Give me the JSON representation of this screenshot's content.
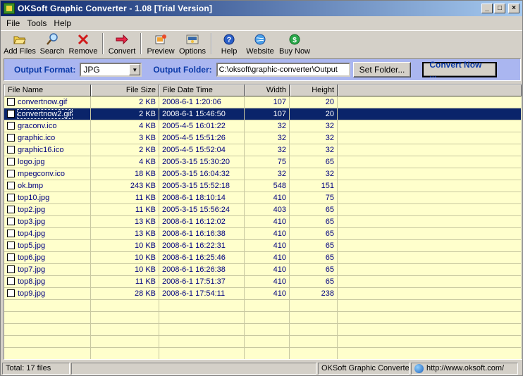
{
  "window": {
    "title": "OKSoft Graphic Converter - 1.08  [Trial Version]",
    "controls": {
      "minimize": "_",
      "maximize": "□",
      "close": "×"
    }
  },
  "menu": [
    {
      "label": "File"
    },
    {
      "label": "Tools"
    },
    {
      "label": "Help"
    }
  ],
  "toolbar": [
    {
      "label": "Add Files",
      "icon": "folder-open-icon"
    },
    {
      "label": "Search",
      "icon": "search-icon"
    },
    {
      "label": "Remove",
      "icon": "remove-x-icon"
    },
    {
      "label": "Convert",
      "icon": "convert-arrow-icon"
    },
    {
      "label": "Preview",
      "icon": "preview-icon"
    },
    {
      "label": "Options",
      "icon": "options-icon"
    },
    {
      "label": "Help",
      "icon": "help-icon"
    },
    {
      "label": "Website",
      "icon": "website-globe-icon"
    },
    {
      "label": "Buy Now",
      "icon": "buy-now-icon"
    }
  ],
  "format_bar": {
    "output_format_label": "Output Format:",
    "output_format_value": "JPG",
    "output_folder_label": "Output Folder:",
    "output_folder_value": "C:\\oksoft\\graphic-converter\\Output",
    "set_folder_label": "Set Folder...",
    "convert_now_label": "Convert Now ..."
  },
  "columns": {
    "name": "File Name",
    "size": "File Size",
    "date": "File Date Time",
    "width": "Width",
    "height": "Height"
  },
  "files": [
    {
      "name": "convertnow.gif",
      "size": "2 KB",
      "date": "2008-6-1 1:20:06",
      "width": "107",
      "height": "20",
      "selected": false
    },
    {
      "name": "convertnow2.gif",
      "size": "2 KB",
      "date": "2008-6-1 15:46:50",
      "width": "107",
      "height": "20",
      "selected": true
    },
    {
      "name": "graconv.ico",
      "size": "4 KB",
      "date": "2005-4-5 16:01:22",
      "width": "32",
      "height": "32",
      "selected": false
    },
    {
      "name": "graphic.ico",
      "size": "3 KB",
      "date": "2005-4-5 15:51:26",
      "width": "32",
      "height": "32",
      "selected": false
    },
    {
      "name": "graphic16.ico",
      "size": "2 KB",
      "date": "2005-4-5 15:52:04",
      "width": "32",
      "height": "32",
      "selected": false
    },
    {
      "name": "logo.jpg",
      "size": "4 KB",
      "date": "2005-3-15 15:30:20",
      "width": "75",
      "height": "65",
      "selected": false
    },
    {
      "name": "mpegconv.ico",
      "size": "18 KB",
      "date": "2005-3-15 16:04:32",
      "width": "32",
      "height": "32",
      "selected": false
    },
    {
      "name": "ok.bmp",
      "size": "243 KB",
      "date": "2005-3-15 15:52:18",
      "width": "548",
      "height": "151",
      "selected": false
    },
    {
      "name": "top10.jpg",
      "size": "11 KB",
      "date": "2008-6-1 18:10:14",
      "width": "410",
      "height": "75",
      "selected": false
    },
    {
      "name": "top2.jpg",
      "size": "11 KB",
      "date": "2005-3-15 15:56:24",
      "width": "403",
      "height": "65",
      "selected": false
    },
    {
      "name": "top3.jpg",
      "size": "13 KB",
      "date": "2008-6-1 16:12:02",
      "width": "410",
      "height": "65",
      "selected": false
    },
    {
      "name": "top4.jpg",
      "size": "13 KB",
      "date": "2008-6-1 16:16:38",
      "width": "410",
      "height": "65",
      "selected": false
    },
    {
      "name": "top5.jpg",
      "size": "10 KB",
      "date": "2008-6-1 16:22:31",
      "width": "410",
      "height": "65",
      "selected": false
    },
    {
      "name": "top6.jpg",
      "size": "10 KB",
      "date": "2008-6-1 16:25:46",
      "width": "410",
      "height": "65",
      "selected": false
    },
    {
      "name": "top7.jpg",
      "size": "10 KB",
      "date": "2008-6-1 16:26:38",
      "width": "410",
      "height": "65",
      "selected": false
    },
    {
      "name": "top8.jpg",
      "size": "11 KB",
      "date": "2008-6-1 17:51:37",
      "width": "410",
      "height": "65",
      "selected": false
    },
    {
      "name": "top9.jpg",
      "size": "28 KB",
      "date": "2008-6-1 17:54:11",
      "width": "410",
      "height": "238",
      "selected": false
    }
  ],
  "status": {
    "total": "Total: 17 files",
    "product": "OKSoft Graphic Converter",
    "url": "http://www.oksoft.com/"
  },
  "colors": {
    "title_gradient_start": "#0a246a",
    "list_background": "#ffffcc",
    "format_bar_background": "#aab6f0",
    "selected_row": "#0a246a",
    "text_blue": "#000080"
  }
}
